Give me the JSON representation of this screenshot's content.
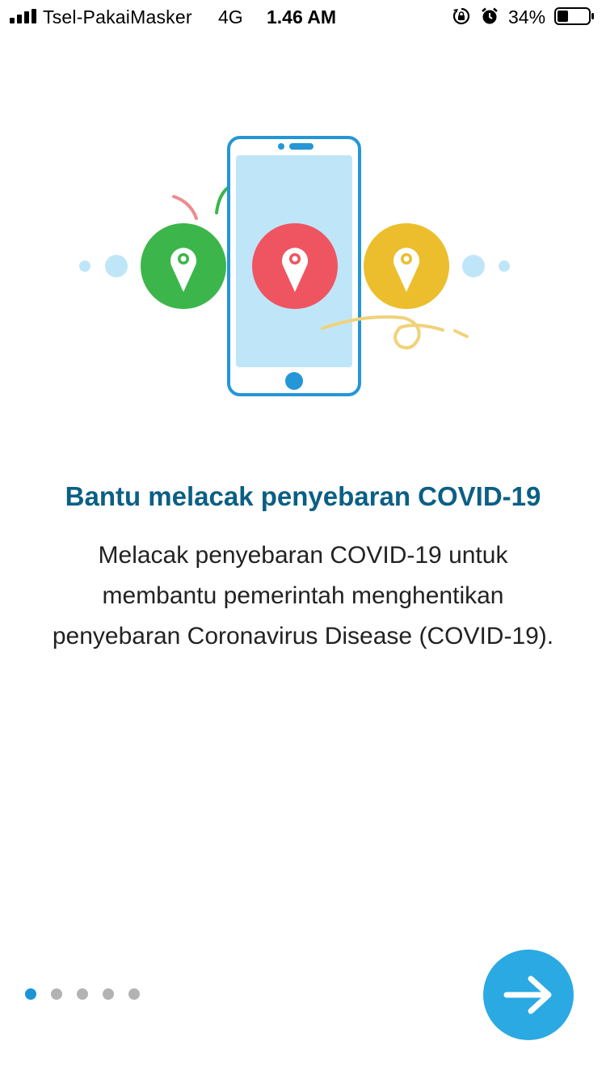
{
  "status_bar": {
    "carrier": "Tsel-PakaiMasker",
    "network": "4G",
    "time": "1.46 AM",
    "battery_percent": "34%",
    "icons": [
      "signal-bars-icon",
      "rotation-lock-icon",
      "alarm-icon",
      "battery-icon"
    ],
    "battery_level": 0.34
  },
  "onboarding": {
    "illustration": "phone-with-location-pins-illustration",
    "title": "Bantu melacak penyebaran COVID-19",
    "description_lines": [
      "Melacak penyebaran COVID-19 untuk",
      "membantu pemerintah menghentikan",
      "penyebaran Coronavirus Disease (COVID-19)."
    ],
    "pager": {
      "total": 5,
      "active_index": 0
    },
    "next_icon": "arrow-right-icon"
  },
  "colors": {
    "title": "#0b5f84",
    "accent": "#2aa9e3",
    "dot_active": "#1b95d8",
    "dot_inactive": "#b3b3b3",
    "pin_green": "#3cb64a",
    "pin_red": "#ef5561",
    "pin_yellow": "#ecbe2d",
    "phone_outline": "#2596d6",
    "phone_screen": "#bfe6f8"
  }
}
